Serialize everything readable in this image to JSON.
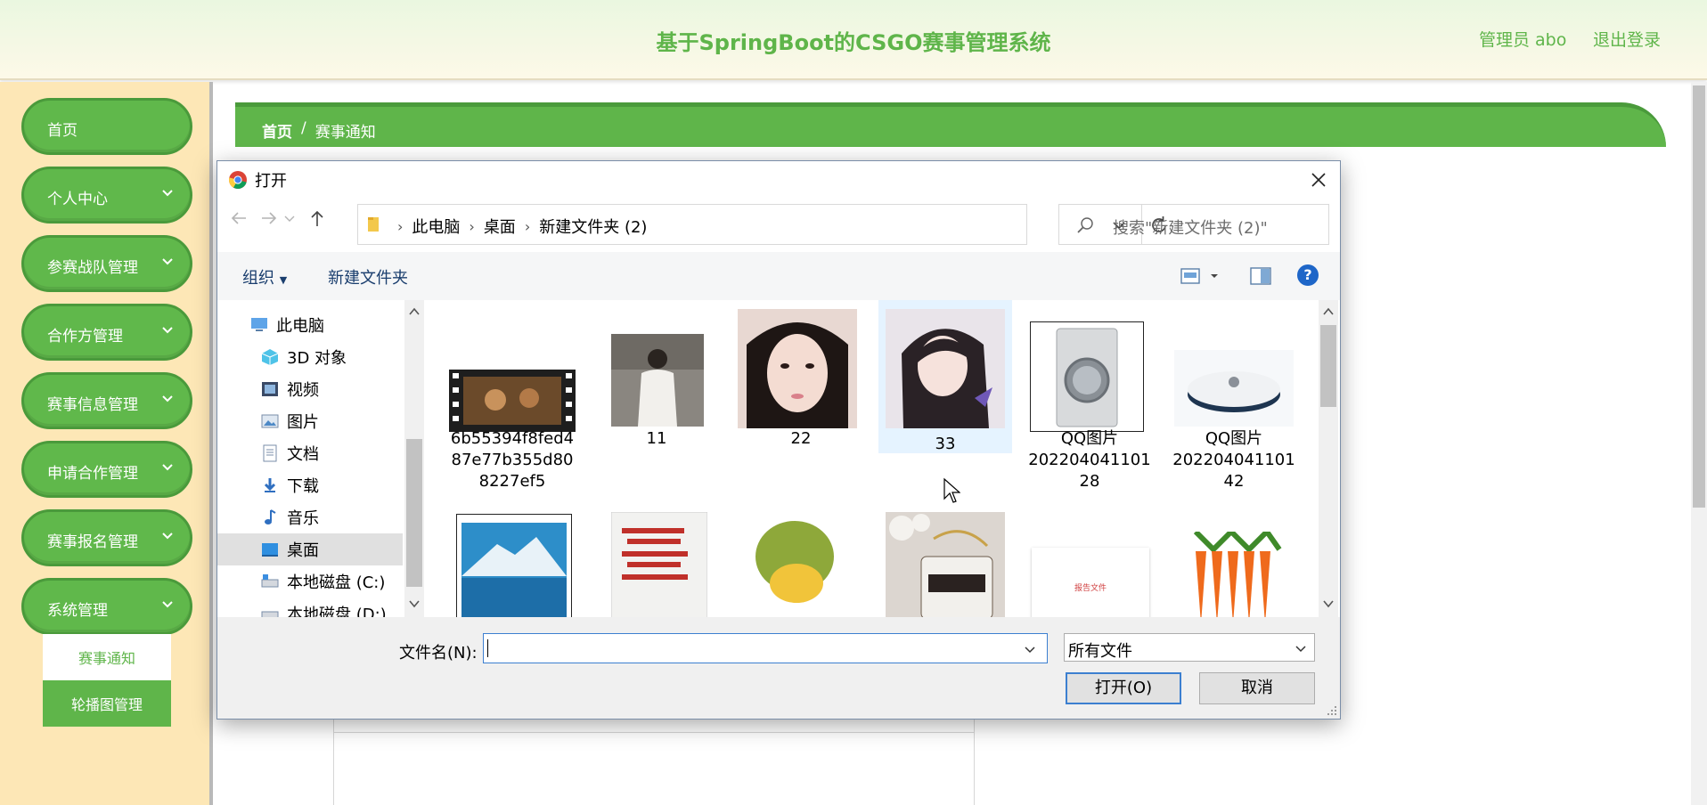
{
  "header": {
    "title": "基于SpringBoot的CSGO赛事管理系统",
    "admin_label": "管理员 abo",
    "logout_label": "退出登录"
  },
  "sidebar": {
    "items": [
      {
        "label": "首页",
        "has_chevron": false
      },
      {
        "label": "个人中心",
        "has_chevron": true
      },
      {
        "label": "参赛战队管理",
        "has_chevron": true
      },
      {
        "label": "合作方管理",
        "has_chevron": true
      },
      {
        "label": "赛事信息管理",
        "has_chevron": true
      },
      {
        "label": "申请合作管理",
        "has_chevron": true
      },
      {
        "label": "赛事报名管理",
        "has_chevron": true
      },
      {
        "label": "系统管理",
        "has_chevron": true
      }
    ],
    "submenu": [
      "赛事通知",
      "轮播图管理"
    ],
    "active_submenu": "赛事通知"
  },
  "breadcrumb": {
    "home": "首页",
    "separator": "/",
    "current": "赛事通知"
  },
  "dialog": {
    "title": "打开",
    "address": {
      "crumbs": [
        "此电脑",
        "桌面",
        "新建文件夹 (2)"
      ],
      "search_placeholder": "搜索\"新建文件夹 (2)\""
    },
    "commands": {
      "organize": "组织",
      "new_folder": "新建文件夹",
      "help": "?"
    },
    "nav_tree": [
      {
        "label": "此电脑",
        "icon": "computer-icon"
      },
      {
        "label": "3D 对象",
        "icon": "3d-objects-icon"
      },
      {
        "label": "视频",
        "icon": "video-folder-icon"
      },
      {
        "label": "图片",
        "icon": "pictures-folder-icon"
      },
      {
        "label": "文档",
        "icon": "documents-folder-icon"
      },
      {
        "label": "下载",
        "icon": "download-icon"
      },
      {
        "label": "音乐",
        "icon": "music-icon"
      },
      {
        "label": "桌面",
        "icon": "desktop-icon",
        "selected": true
      },
      {
        "label": "本地磁盘 (C:)",
        "icon": "drive-icon"
      },
      {
        "label": "本地磁盘 (D:)",
        "icon": "drive-icon"
      }
    ],
    "files": [
      {
        "name": "6b55394f8fed487e77b355d808227ef5",
        "lines": [
          "6b55394f8fed4",
          "87e77b355d80",
          "8227ef5"
        ],
        "thumb": "video-thumbnail"
      },
      {
        "name": "11",
        "lines": [
          "11"
        ],
        "thumb": "person-photo-thumbnail"
      },
      {
        "name": "22",
        "lines": [
          "22"
        ],
        "thumb": "portrait-photo-thumbnail"
      },
      {
        "name": "33",
        "lines": [
          "33"
        ],
        "thumb": "illustration-thumbnail",
        "selected": true
      },
      {
        "name": "QQ图片20220404110128",
        "lines": [
          "QQ图片",
          "202204041101",
          "28"
        ],
        "thumb": "washing-machine-thumbnail"
      },
      {
        "name": "QQ图片20220404110142",
        "lines": [
          "QQ图片",
          "202204041101",
          "42"
        ],
        "thumb": "robot-vacuum-thumbnail"
      },
      {
        "name": "",
        "lines": [],
        "thumb": "mountain-lake-thumbnail"
      },
      {
        "name": "",
        "lines": [],
        "thumb": "book-cover-thumbnail"
      },
      {
        "name": "",
        "lines": [],
        "thumb": "jackfruit-thumbnail"
      },
      {
        "name": "",
        "lines": [],
        "thumb": "handbag-thumbnail"
      },
      {
        "name": "",
        "lines": [],
        "thumb": "report-document-thumbnail",
        "thumb_text": "报告文件"
      },
      {
        "name": "",
        "lines": [],
        "thumb": "carrots-thumbnail"
      }
    ],
    "filename": {
      "label": "文件名(N):",
      "value": ""
    },
    "file_type": "所有文件",
    "open_button": "打开(O)",
    "cancel_button": "取消"
  },
  "colors": {
    "brand_green": "#5fb54a",
    "sidebar_bg": "#fde7b6",
    "focus_blue": "#3c7fd0",
    "selection_blue": "#e5f3ff"
  }
}
